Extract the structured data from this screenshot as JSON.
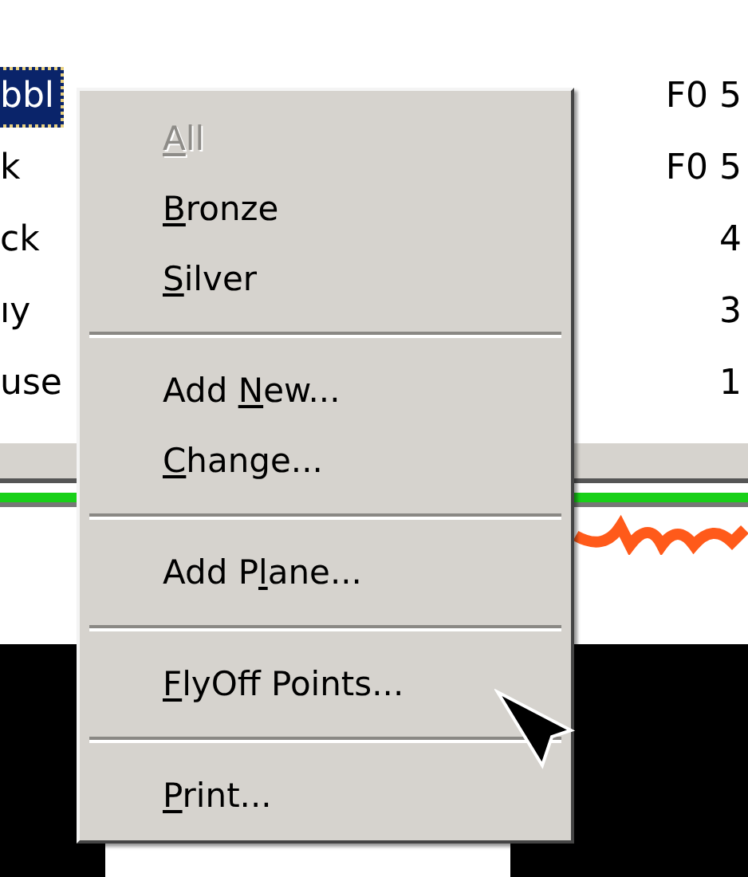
{
  "list": {
    "rows": [
      {
        "column_1": "bbl",
        "column_2": "F0 5",
        "selected": true
      },
      {
        "column_1": "k",
        "column_2": "F0 5",
        "selected": false
      },
      {
        "column_1": "ck",
        "column_2": "4",
        "selected": false
      },
      {
        "column_1": "ıy",
        "column_2": "3",
        "selected": false
      },
      {
        "column_1": "use",
        "column_2": "1",
        "selected": false
      }
    ]
  },
  "context_menu": {
    "items": [
      {
        "kind": "item",
        "key": "A",
        "post": "ll",
        "disabled": true
      },
      {
        "kind": "item",
        "key": "B",
        "post": "ronze",
        "disabled": false
      },
      {
        "kind": "item",
        "key": "S",
        "post": "ilver",
        "disabled": false
      },
      {
        "kind": "separator"
      },
      {
        "kind": "item",
        "pre": "Add ",
        "key": "N",
        "post": "ew...",
        "disabled": false
      },
      {
        "kind": "item",
        "key": "C",
        "post": "hange...",
        "disabled": false
      },
      {
        "kind": "separator"
      },
      {
        "kind": "item",
        "pre": "Add P",
        "key": "l",
        "post": "ane...",
        "disabled": false
      },
      {
        "kind": "separator"
      },
      {
        "kind": "item",
        "key": "F",
        "post": "lyOff Points...",
        "disabled": false
      },
      {
        "kind": "separator"
      },
      {
        "kind": "item",
        "key": "P",
        "post": "rint...",
        "disabled": false
      }
    ]
  }
}
